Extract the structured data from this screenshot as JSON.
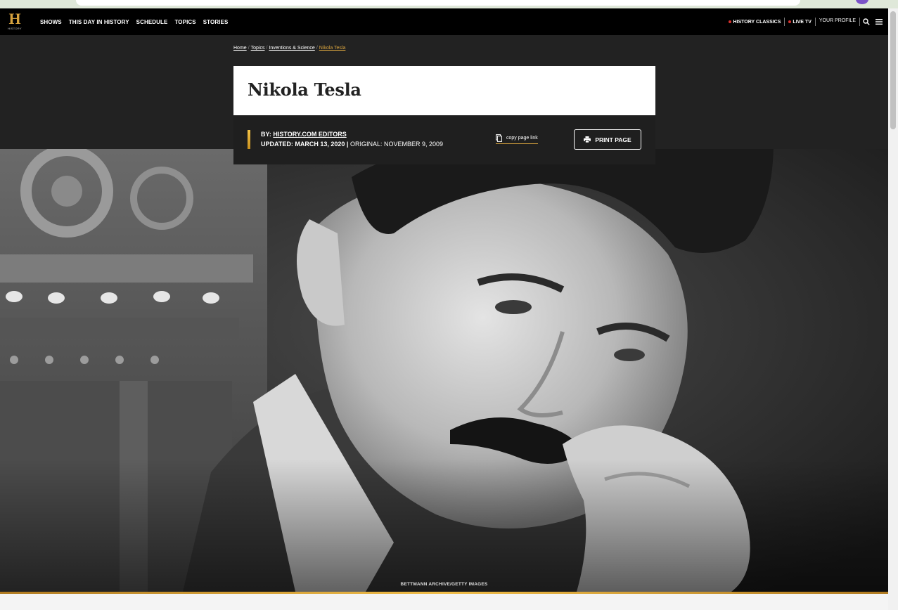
{
  "header": {
    "logo_letter": "H",
    "logo_word": "HISTORY",
    "nav": [
      "SHOWS",
      "THIS DAY IN HISTORY",
      "SCHEDULE",
      "TOPICS",
      "STORIES"
    ],
    "history_classics": "HISTORY CLASSICS",
    "live_tv": "LIVE TV",
    "your_profile": "YOUR PROFILE",
    "icons": [
      "search-icon",
      "menu-icon"
    ]
  },
  "breadcrumb": {
    "home": "Home",
    "topics": "Topics",
    "category": "Inventions & Science",
    "current": "Nikola Tesla",
    "separator": "/"
  },
  "article": {
    "title": "Nikola Tesla",
    "by_label": "BY:",
    "author": "HISTORY.COM EDITORS",
    "updated_label": "UPDATED:",
    "updated_date": "MARCH 13, 2020",
    "divider": "|",
    "original_label": "ORIGINAL:",
    "original_date": "NOVEMBER 9, 2009",
    "copy_link": "copy page link",
    "print": "PRINT PAGE"
  },
  "hero": {
    "caption": "BETTMANN ARCHIVE/GETTY IMAGES"
  },
  "colors": {
    "accent_gold": "#d6a23e",
    "live_dot": "#d6312d",
    "header_bg": "#000000",
    "hero_bg": "#222222"
  }
}
